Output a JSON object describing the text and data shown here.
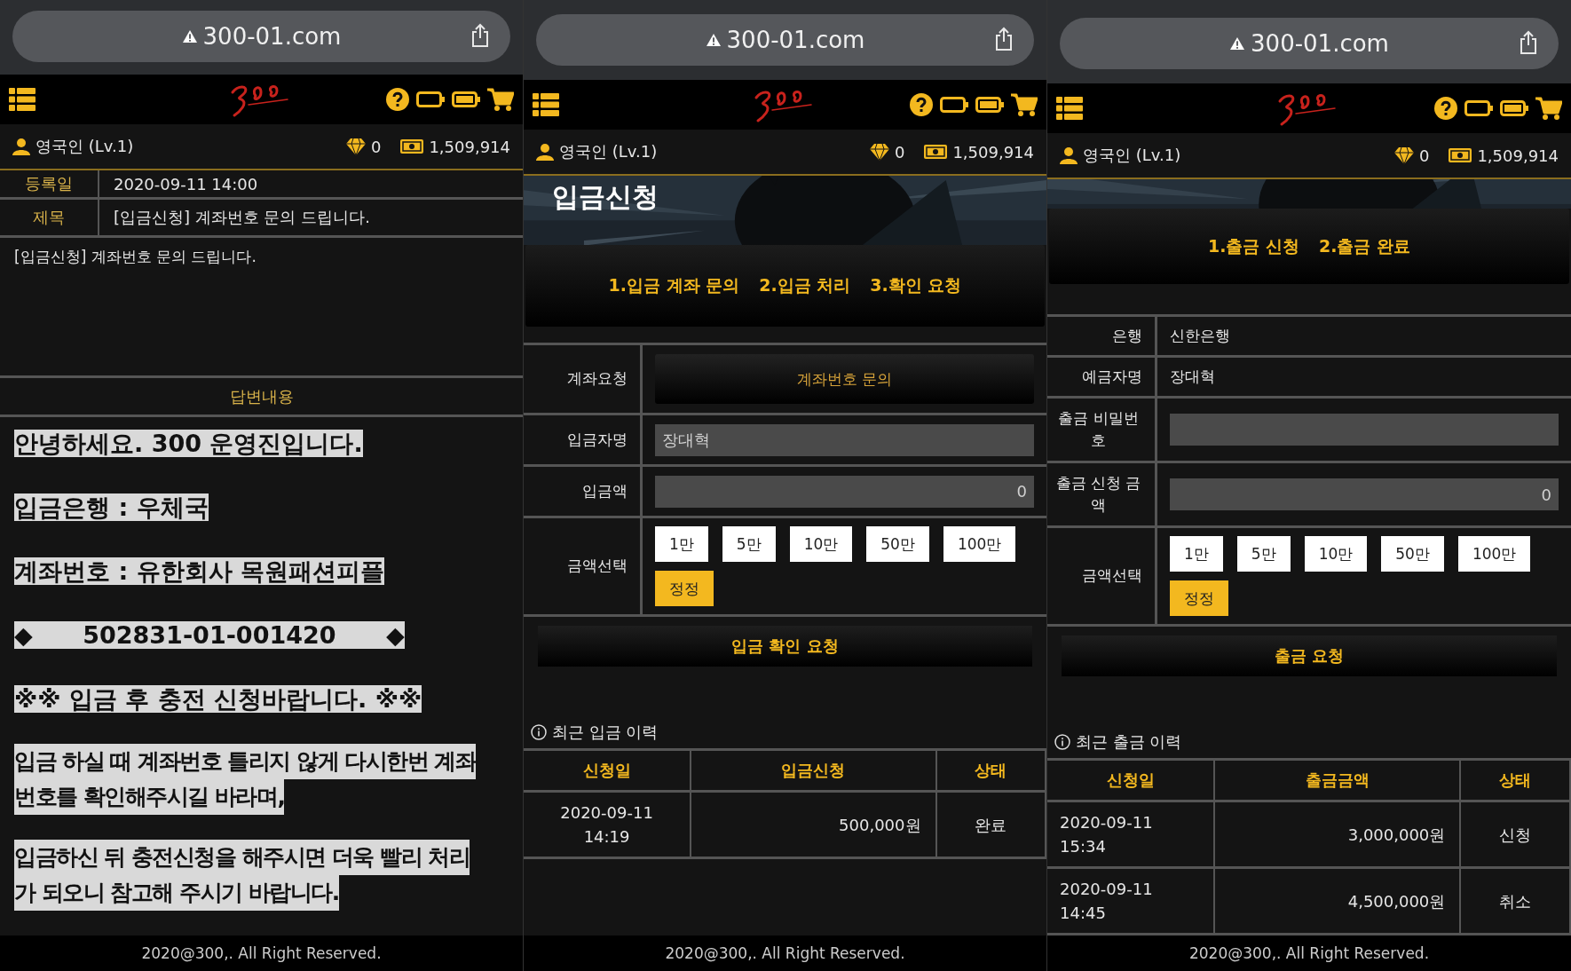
{
  "panels": [
    {
      "kind": "inquiry",
      "url": "300-01.com",
      "user": "영국인 (Lv.1)",
      "points": "0",
      "balance": "1,509,914",
      "meta": [
        {
          "label": "등록일",
          "value": "2020-09-11 14:00"
        },
        {
          "label": "제목",
          "value": "[입금신청] 계좌번호 문의 드립니다."
        }
      ],
      "body": "[입금신청] 계좌번호 문의 드립니다.",
      "answer_heading": "답변내용",
      "answer": [
        "안녕하세요. 300 운영진입니다.",
        "입금은행 : 우체국",
        "계좌번호 : 유한회사 목원패션피플",
        "◆      502831-01-001420      ◆",
        "※※ 입금 후 충전 신청바랍니다. ※※",
        [
          "입금 하실 때 계좌번호 틀리지 않게 다시한번 계좌",
          "번호를 확인해주시길 바라며,"
        ],
        [
          "입금하신 뒤 충전신청을 해주시면 더욱 빨리 처리",
          "가 되오니 참고해 주시기 바랍니다."
        ]
      ],
      "footer": "2020@300,. All Right Reserved."
    },
    {
      "kind": "deposit",
      "url": "300-01.com",
      "user": "영국인 (Lv.1)",
      "points": "0",
      "balance": "1,509,914",
      "title": "입금신청",
      "steps": [
        "1.입금 계좌 문의",
        "2.입금 처리",
        "3.확인 요청"
      ],
      "form": [
        {
          "kind": "button",
          "label": "계좌요청",
          "value": "계좌번호 문의"
        },
        {
          "kind": "input",
          "label": "입금자명",
          "value": "장대혁"
        },
        {
          "kind": "amount",
          "label": "입금액",
          "value": "0"
        },
        {
          "kind": "chips",
          "label": "금액선택",
          "chips": [
            "1만",
            "5만",
            "10만",
            "50만",
            "100만"
          ],
          "reset": "정정"
        }
      ],
      "submit": "입금 확인 요청",
      "history_title": "최근 입금 이력",
      "columns": [
        "신청일",
        "입금신청",
        "상태"
      ],
      "rows": [
        [
          "2020-09-11\n14:19",
          "500,000원",
          "완료"
        ]
      ],
      "footer": "2020@300,. All Right Reserved."
    },
    {
      "kind": "withdraw",
      "url": "300-01.com",
      "user": "영국인 (Lv.1)",
      "points": "0",
      "balance": "1,509,914",
      "steps": [
        "1.출금 신청",
        "2.출금 완료"
      ],
      "form": [
        {
          "kind": "text",
          "label": "은행",
          "value": "신한은행"
        },
        {
          "kind": "text",
          "label": "예금자명",
          "value": "장대혁"
        },
        {
          "kind": "password",
          "label": "출금 비밀번호"
        },
        {
          "kind": "amount",
          "label": "출금 신청 금액",
          "value": "0"
        },
        {
          "kind": "chips",
          "label": "금액선택",
          "chips": [
            "1만",
            "5만",
            "10만",
            "50만",
            "100만"
          ],
          "reset": "정정"
        }
      ],
      "submit": "출금 요청",
      "history_title": "최근 출금 이력",
      "columns": [
        "신청일",
        "출금금액",
        "상태"
      ],
      "rows": [
        [
          "2020-09-11\n15:34",
          "3,000,000원",
          "신청"
        ],
        [
          "2020-09-11\n14:45",
          "4,500,000원",
          "취소"
        ]
      ],
      "footer": "2020@300,. All Right Reserved."
    }
  ]
}
